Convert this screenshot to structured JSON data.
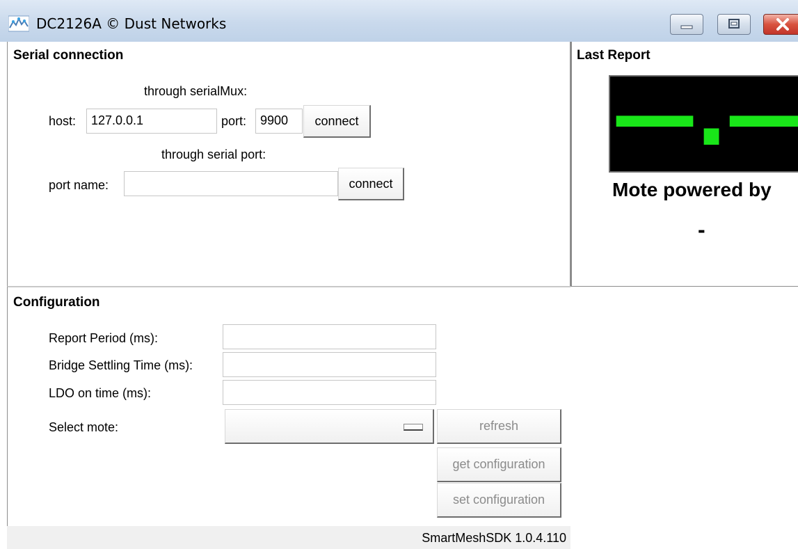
{
  "window": {
    "title": "DC2126A © Dust Networks",
    "icon": "app-icon"
  },
  "serial": {
    "section_title": "Serial connection",
    "mux_heading": "through serialMux:",
    "host_label": "host:",
    "host_value": "127.0.0.1",
    "port_label": "port:",
    "port_value": "9900",
    "mux_connect_label": "connect",
    "serial_heading": "through serial port:",
    "port_name_label": "port name:",
    "port_name_value": "",
    "serial_connect_label": "connect"
  },
  "report": {
    "section_title": "Last Report",
    "temperature_text": "—.—°C",
    "powered_label": "Mote powered by",
    "powered_value": "-",
    "display_color": "#19e619"
  },
  "configuration": {
    "section_title": "Configuration",
    "report_period_label": "Report Period (ms):",
    "bridge_settling_label": "Bridge Settling Time (ms):",
    "ldo_label": "LDO on time (ms):",
    "select_mote_label": "Select mote:",
    "refresh_label": "refresh",
    "get_config_label": "get configuration",
    "set_config_label": "set configuration"
  },
  "status": {
    "version": "SmartMeshSDK 1.0.4.110"
  }
}
